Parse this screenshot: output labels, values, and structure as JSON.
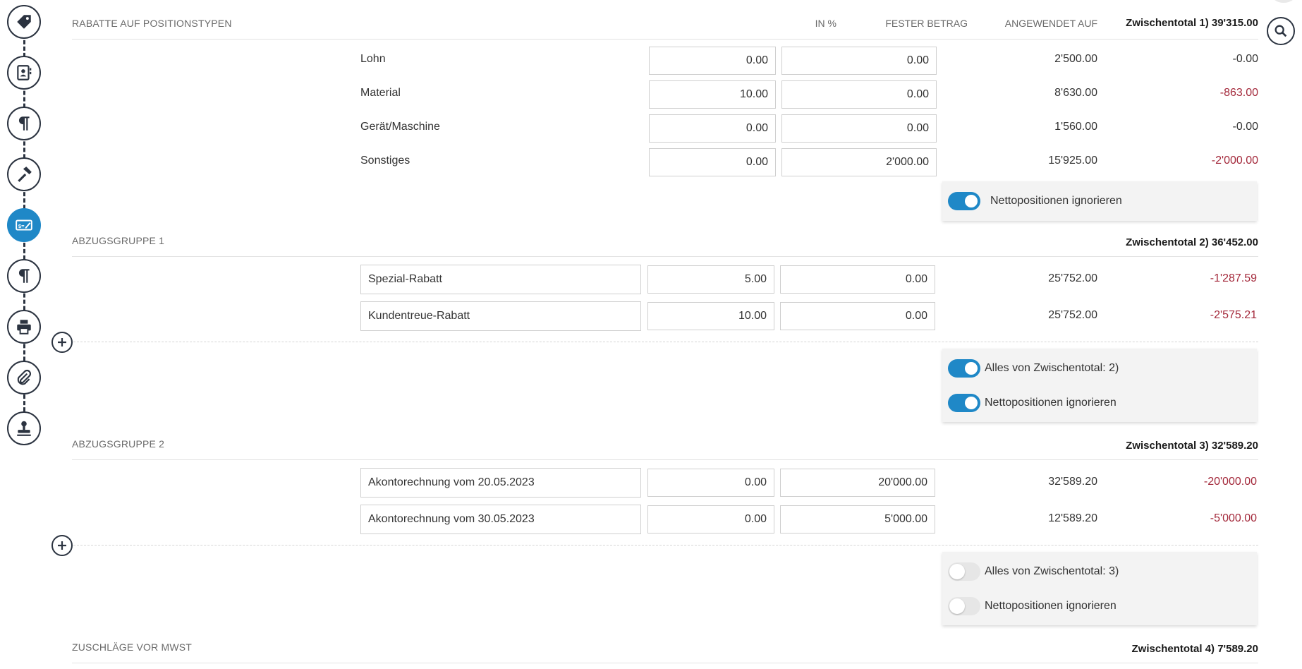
{
  "rail": {
    "icons": [
      "tag-icon",
      "contact-card-icon",
      "paragraph-icon",
      "hammer-icon",
      "discount-icon",
      "paragraph-icon",
      "printer-icon",
      "paperclip-icon",
      "stamp-icon"
    ]
  },
  "columns": {
    "percent": "IN %",
    "fixed": "FESTER BETRAG",
    "applied": "ANGEWENDET AUF"
  },
  "section1": {
    "title": "RABATTE AUF POSITIONSTYPEN",
    "total": "Zwischentotal 1) 39'315.00",
    "rows": [
      {
        "label": "Lohn",
        "percent": "0.00",
        "fixed": "0.00",
        "applied": "2'500.00",
        "result": "-0.00"
      },
      {
        "label": "Material",
        "percent": "10.00",
        "fixed": "0.00",
        "applied": "8'630.00",
        "result": "-863.00"
      },
      {
        "label": "Gerät/Maschine",
        "percent": "0.00",
        "fixed": "0.00",
        "applied": "1'560.00",
        "result": "-0.00"
      },
      {
        "label": "Sonstiges",
        "percent": "0.00",
        "fixed": "2'000.00",
        "applied": "15'925.00",
        "result": "-2'000.00"
      }
    ],
    "toggles": [
      {
        "label": "Nettopositionen ignorieren",
        "on": true
      }
    ]
  },
  "section2": {
    "title": "ABZUGSGRUPPE 1",
    "total": "Zwischentotal 2) 36'452.00",
    "rows": [
      {
        "label": "Spezial-Rabatt",
        "percent": "5.00",
        "fixed": "0.00",
        "applied": "25'752.00",
        "result": "-1'287.59"
      },
      {
        "label": "Kundentreue-Rabatt",
        "percent": "10.00",
        "fixed": "0.00",
        "applied": "25'752.00",
        "result": "-2'575.21"
      }
    ],
    "toggles": [
      {
        "label": "Alles von Zwischentotal: 2)",
        "on": true
      },
      {
        "label": "Nettopositionen ignorieren",
        "on": true
      }
    ]
  },
  "section3": {
    "title": "ABZUGSGRUPPE 2",
    "total": "Zwischentotal 3) 32'589.20",
    "rows": [
      {
        "label": "Akontorechnung vom 20.05.2023",
        "percent": "0.00",
        "fixed": "20'000.00",
        "applied": "32'589.20",
        "result": "-20'000.00"
      },
      {
        "label": "Akontorechnung vom 30.05.2023",
        "percent": "0.00",
        "fixed": "5'000.00",
        "applied": "12'589.20",
        "result": "-5'000.00"
      }
    ],
    "toggles": [
      {
        "label": "Alles von Zwischentotal: 3)",
        "on": false
      },
      {
        "label": "Nettopositionen ignorieren",
        "on": false
      }
    ]
  },
  "section4": {
    "title": "ZUSCHLÄGE VOR MWST",
    "total": "Zwischentotal 4) 7'589.20"
  },
  "colors": {
    "accent": "#1f88c7",
    "negative": "#a3283a",
    "dark": "#2b3340"
  }
}
